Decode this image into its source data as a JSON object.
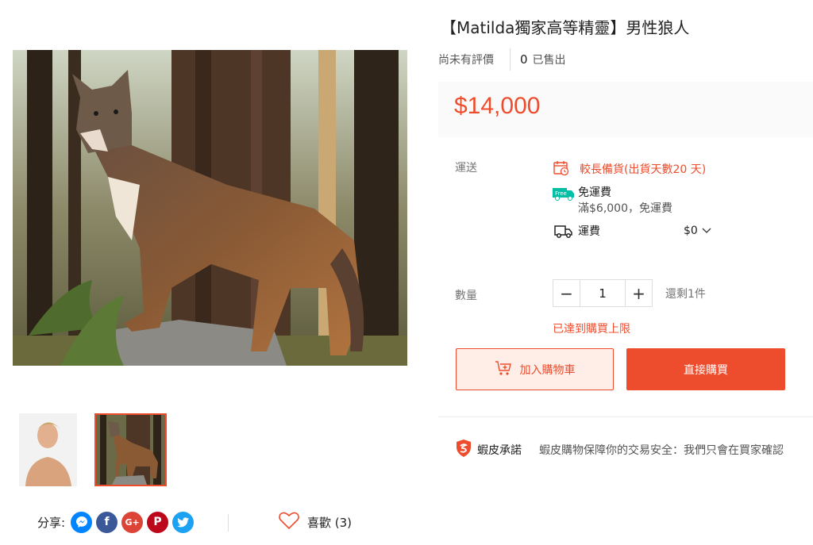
{
  "product": {
    "title": "【Matilda獨家高等精靈】男性狼人",
    "rating_text": "尚未有評價",
    "sold_count": "0",
    "sold_label": "已售出",
    "price": "$14,000"
  },
  "shipping": {
    "label": "運送",
    "long_prep": "較長備貨(出貨天數20 天)",
    "free_badge": "Free",
    "free_title": "免運費",
    "free_condition": "滿$6,000，免運費",
    "fee_label": "運費",
    "fee_value": "$0"
  },
  "quantity": {
    "label": "數量",
    "minus": "−",
    "value": "1",
    "plus": "+",
    "stock": "還剩1件",
    "limit_msg": "已達到購買上限"
  },
  "actions": {
    "add_to_cart": "加入購物車",
    "buy_now": "直接購買"
  },
  "guarantee": {
    "title": "蝦皮承諾",
    "description": "蝦皮購物保障你的交易安全：我們只會在買家確認"
  },
  "share": {
    "label": "分享:",
    "networks": [
      "messenger-icon",
      "facebook-icon",
      "google-plus-icon",
      "pinterest-icon",
      "twitter-icon"
    ]
  },
  "like": {
    "label": "喜歡 (3)"
  },
  "colors": {
    "accent": "#ee4d2d",
    "free_badge": "#00bfa5"
  }
}
